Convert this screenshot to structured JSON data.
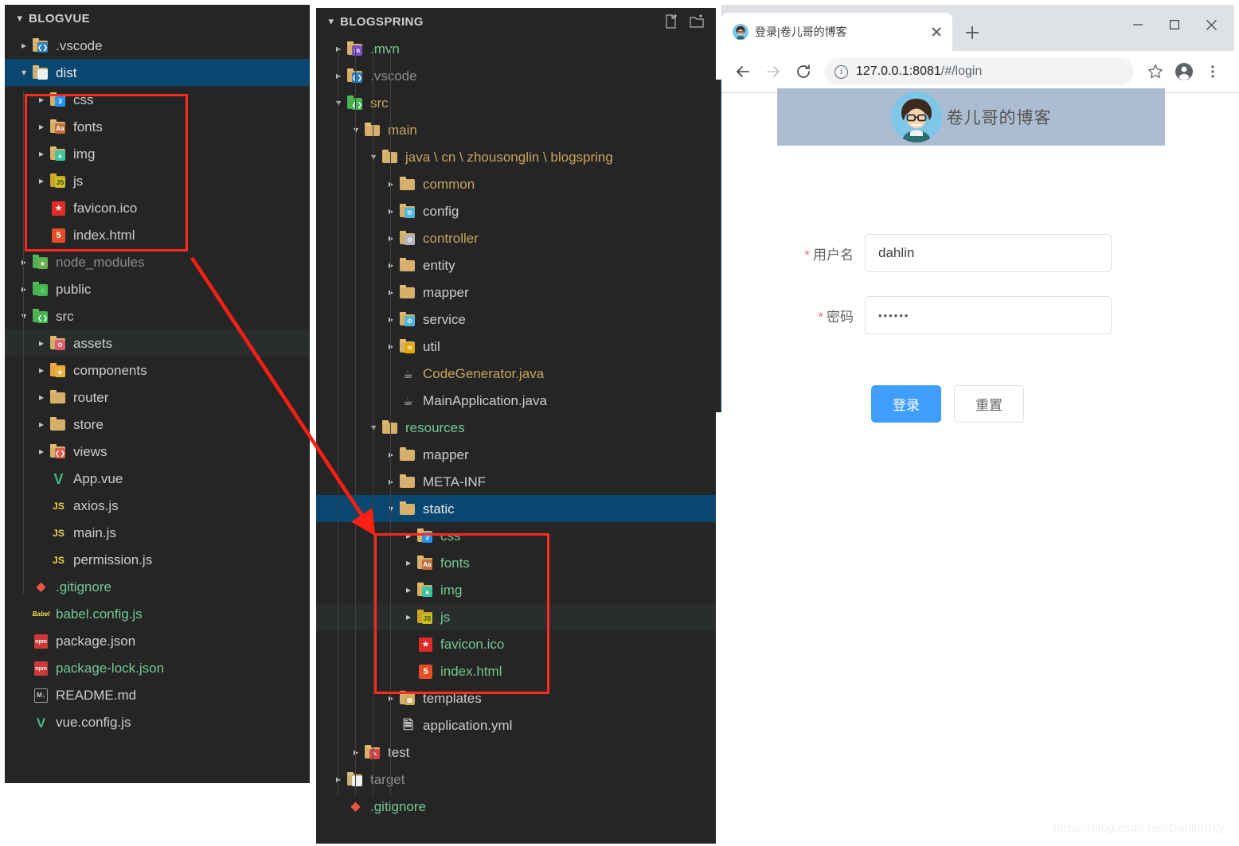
{
  "panels": {
    "left": {
      "title": "BLOGVUE",
      "items": [
        {
          "label": ".vscode",
          "twisty": "collapsed",
          "indent": 1,
          "icon": "folder-vscode",
          "color": "c-default"
        },
        {
          "label": "dist",
          "twisty": "expanded",
          "indent": 1,
          "icon": "folder-dist",
          "color": "c-white",
          "state": "selected"
        },
        {
          "label": "css",
          "twisty": "collapsed",
          "indent": 2,
          "icon": "folder-css",
          "color": "c-default"
        },
        {
          "label": "fonts",
          "twisty": "collapsed",
          "indent": 2,
          "icon": "folder-fonts",
          "color": "c-default"
        },
        {
          "label": "img",
          "twisty": "collapsed",
          "indent": 2,
          "icon": "folder-img",
          "color": "c-default"
        },
        {
          "label": "js",
          "twisty": "collapsed",
          "indent": 2,
          "icon": "folder-js",
          "color": "c-default"
        },
        {
          "label": "favicon.ico",
          "twisty": "none",
          "indent": 2,
          "icon": "file-favicon",
          "color": "c-default"
        },
        {
          "label": "index.html",
          "twisty": "none",
          "indent": 2,
          "icon": "file-html",
          "color": "c-default"
        },
        {
          "label": "node_modules",
          "twisty": "collapsed",
          "indent": 1,
          "icon": "folder-node",
          "color": "c-dim"
        },
        {
          "label": "public",
          "twisty": "collapsed",
          "indent": 1,
          "icon": "folder-public",
          "color": "c-default"
        },
        {
          "label": "src",
          "twisty": "expanded",
          "indent": 1,
          "icon": "folder-src",
          "color": "c-default"
        },
        {
          "label": "assets",
          "twisty": "collapsed",
          "indent": 2,
          "icon": "folder-assets",
          "color": "c-default",
          "state": "hover"
        },
        {
          "label": "components",
          "twisty": "collapsed",
          "indent": 2,
          "icon": "folder-components",
          "color": "c-default"
        },
        {
          "label": "router",
          "twisty": "collapsed",
          "indent": 2,
          "icon": "folder-plain",
          "color": "c-default"
        },
        {
          "label": "store",
          "twisty": "collapsed",
          "indent": 2,
          "icon": "folder-plain",
          "color": "c-default"
        },
        {
          "label": "views",
          "twisty": "collapsed",
          "indent": 2,
          "icon": "folder-views",
          "color": "c-default"
        },
        {
          "label": "App.vue",
          "twisty": "none",
          "indent": 2,
          "icon": "file-vue",
          "color": "c-default"
        },
        {
          "label": "axios.js",
          "twisty": "none",
          "indent": 2,
          "icon": "file-js",
          "color": "c-default"
        },
        {
          "label": "main.js",
          "twisty": "none",
          "indent": 2,
          "icon": "file-js",
          "color": "c-default"
        },
        {
          "label": "permission.js",
          "twisty": "none",
          "indent": 2,
          "icon": "file-js",
          "color": "c-default"
        },
        {
          "label": ".gitignore",
          "twisty": "none",
          "indent": 1,
          "icon": "file-git",
          "color": "c-green"
        },
        {
          "label": "babel.config.js",
          "twisty": "none",
          "indent": 1,
          "icon": "file-babel",
          "color": "c-green"
        },
        {
          "label": "package.json",
          "twisty": "none",
          "indent": 1,
          "icon": "file-npm",
          "color": "c-default"
        },
        {
          "label": "package-lock.json",
          "twisty": "none",
          "indent": 1,
          "icon": "file-npm",
          "color": "c-green"
        },
        {
          "label": "README.md",
          "twisty": "none",
          "indent": 1,
          "icon": "file-md",
          "color": "c-default"
        },
        {
          "label": "vue.config.js",
          "twisty": "none",
          "indent": 1,
          "icon": "file-vuecfg",
          "color": "c-default"
        }
      ]
    },
    "mid": {
      "title": "BLOGSPRING",
      "actions": [
        {
          "name": "new-file-icon",
          "label": "New File"
        },
        {
          "name": "new-folder-icon",
          "label": "New Folder"
        }
      ],
      "items": [
        {
          "label": ".mvn",
          "twisty": "collapsed",
          "indent": 1,
          "icon": "folder-mvn",
          "color": "c-green"
        },
        {
          "label": ".vscode",
          "twisty": "collapsed",
          "indent": 1,
          "icon": "folder-vscode",
          "color": "c-dim"
        },
        {
          "label": "src",
          "twisty": "expanded",
          "indent": 1,
          "icon": "folder-src",
          "color": "c-gold"
        },
        {
          "label": "main",
          "twisty": "expanded",
          "indent": 2,
          "icon": "folder-plain",
          "color": "c-gold"
        },
        {
          "label": "java \\ cn \\ zhousonglin \\ blogspring",
          "twisty": "expanded",
          "indent": 3,
          "icon": "folder-plain",
          "color": "c-gold"
        },
        {
          "label": "common",
          "twisty": "collapsed",
          "indent": 4,
          "icon": "folder-plain",
          "color": "c-gold"
        },
        {
          "label": "config",
          "twisty": "collapsed",
          "indent": 4,
          "icon": "folder-config",
          "color": "c-default"
        },
        {
          "label": "controller",
          "twisty": "collapsed",
          "indent": 4,
          "icon": "folder-controller",
          "color": "c-gold"
        },
        {
          "label": "entity",
          "twisty": "collapsed",
          "indent": 4,
          "icon": "folder-plain",
          "color": "c-default"
        },
        {
          "label": "mapper",
          "twisty": "collapsed",
          "indent": 4,
          "icon": "folder-plain",
          "color": "c-default"
        },
        {
          "label": "service",
          "twisty": "collapsed",
          "indent": 4,
          "icon": "folder-service",
          "color": "c-default"
        },
        {
          "label": "util",
          "twisty": "collapsed",
          "indent": 4,
          "icon": "folder-util",
          "color": "c-default"
        },
        {
          "label": "CodeGenerator.java",
          "twisty": "none",
          "indent": 4,
          "icon": "file-java",
          "color": "c-gold"
        },
        {
          "label": "MainApplication.java",
          "twisty": "none",
          "indent": 4,
          "icon": "file-java",
          "color": "c-default"
        },
        {
          "label": "resources",
          "twisty": "expanded",
          "indent": 3,
          "icon": "folder-plain",
          "color": "c-green"
        },
        {
          "label": "mapper",
          "twisty": "collapsed",
          "indent": 4,
          "icon": "folder-plain",
          "color": "c-default"
        },
        {
          "label": "META-INF",
          "twisty": "collapsed",
          "indent": 4,
          "icon": "folder-plain",
          "color": "c-default"
        },
        {
          "label": "static",
          "twisty": "expanded",
          "indent": 4,
          "icon": "folder-plain",
          "color": "c-white",
          "state": "selected"
        },
        {
          "label": "css",
          "twisty": "collapsed",
          "indent": 5,
          "icon": "folder-css",
          "color": "c-green"
        },
        {
          "label": "fonts",
          "twisty": "collapsed",
          "indent": 5,
          "icon": "folder-fonts",
          "color": "c-green"
        },
        {
          "label": "img",
          "twisty": "collapsed",
          "indent": 5,
          "icon": "folder-img",
          "color": "c-green"
        },
        {
          "label": "js",
          "twisty": "collapsed",
          "indent": 5,
          "icon": "folder-js",
          "color": "c-green",
          "state": "hover"
        },
        {
          "label": "favicon.ico",
          "twisty": "none",
          "indent": 5,
          "icon": "file-favicon",
          "color": "c-green"
        },
        {
          "label": "index.html",
          "twisty": "none",
          "indent": 5,
          "icon": "file-html",
          "color": "c-green"
        },
        {
          "label": "templates",
          "twisty": "collapsed",
          "indent": 4,
          "icon": "folder-templates",
          "color": "c-default"
        },
        {
          "label": "application.yml",
          "twisty": "none",
          "indent": 4,
          "icon": "file-yml",
          "color": "c-default"
        },
        {
          "label": "test",
          "twisty": "collapsed",
          "indent": 2,
          "icon": "folder-test",
          "color": "c-default"
        },
        {
          "label": "target",
          "twisty": "collapsed",
          "indent": 1,
          "icon": "folder-target",
          "color": "c-dim"
        },
        {
          "label": ".gitignore",
          "twisty": "none",
          "indent": 1,
          "icon": "file-git",
          "color": "c-green"
        }
      ]
    }
  },
  "browser": {
    "tab": {
      "title": "登录|卷儿哥的博客",
      "favicon_name": "avatar-favicon",
      "close_name": "tab-close-icon"
    },
    "new_tab_label": "+",
    "window_controls": {
      "minimize": "minimize-icon",
      "maximize": "maximize-icon",
      "close": "close-icon"
    },
    "toolbar": {
      "back": "back-arrow-icon",
      "forward": "forward-arrow-icon",
      "reload": "reload-icon",
      "site_info": "site-info-icon",
      "url": "127.0.0.1:8081",
      "url_path": "/#/login",
      "bookmark": "star-icon",
      "profile": "profile-avatar-icon",
      "menu": "kebab-menu-icon"
    }
  },
  "login": {
    "banner_title": "卷儿哥的博客",
    "banner_bg": "#adbdd1",
    "fields": [
      {
        "name": "username",
        "label": "用户名",
        "required_mark": "*",
        "value": "dahlin",
        "placeholder": ""
      },
      {
        "name": "password",
        "label": "密码",
        "required_mark": "*",
        "value": "••••••",
        "placeholder": ""
      }
    ],
    "buttons": [
      {
        "name": "login",
        "label": "登录",
        "style": "primary",
        "color": "#409eff"
      },
      {
        "name": "reset",
        "label": "重置",
        "style": "default"
      }
    ]
  },
  "watermark": "https://blog.csdn.net/DahlinSky",
  "annotations": {
    "box_color": "#ff2a20",
    "arrow_color": "#ff1f12"
  }
}
